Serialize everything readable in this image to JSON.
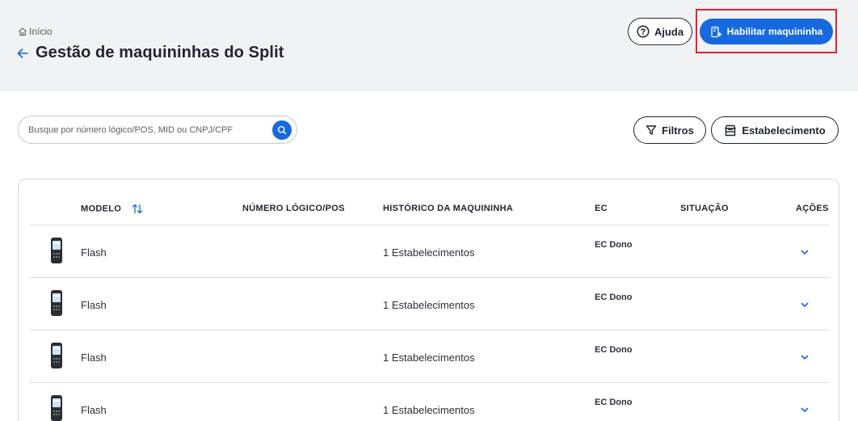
{
  "header": {
    "breadcrumb_home": "Início",
    "title": "Gestão de maquininhas do Split",
    "help_label": "Ajuda",
    "enable_label": "Habilitar maquininha"
  },
  "toolbar": {
    "search_placeholder": "Busque por número lógico/POS, MID ou CNPJ/CPF",
    "filters_label": "Filtros",
    "establishment_label": "Estabelecimento"
  },
  "table": {
    "columns": {
      "model": "MODELO",
      "pos_number": "NÚMERO LÓGICO/POS",
      "history": "HISTÓRICO DA MAQUININHA",
      "ec": "EC",
      "status": "SITUAÇÃO",
      "actions": "AÇÕES"
    },
    "rows": [
      {
        "model": "Flash",
        "pos_number": "",
        "history": "1 Estabelecimentos",
        "ec": "EC Dono",
        "status": ""
      },
      {
        "model": "Flash",
        "pos_number": "",
        "history": "1 Estabelecimentos",
        "ec": "EC Dono",
        "status": ""
      },
      {
        "model": "Flash",
        "pos_number": "",
        "history": "1 Estabelecimentos",
        "ec": "EC Dono",
        "status": ""
      },
      {
        "model": "Flash",
        "pos_number": "",
        "history": "1 Estabelecimentos",
        "ec": "EC Dono",
        "status": ""
      }
    ]
  },
  "colors": {
    "primary": "#1769e0",
    "highlight": "#e0242b",
    "header_bg": "#f1f2f4"
  },
  "icons": {
    "home": "home-icon",
    "back": "arrow-left-icon",
    "help": "question-circle-icon",
    "enable": "pos-add-icon",
    "search": "search-icon",
    "filter": "funnel-icon",
    "store": "store-icon",
    "sort": "sort-arrows-icon",
    "device": "pos-terminal-icon",
    "expand": "chevron-down-icon"
  }
}
